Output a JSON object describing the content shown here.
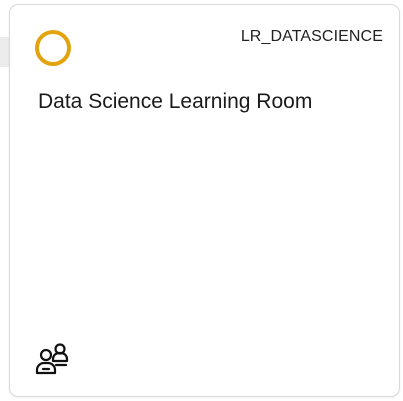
{
  "tile": {
    "code": "LR_DATASCIENCE",
    "title": "Data Science Learning Room"
  },
  "icons": {
    "status": "status-ring-icon",
    "members": "group-members-icon"
  },
  "colors": {
    "status_ring": "#e3a30f",
    "tile_border": "#d9d9d9",
    "text": "#1a1a1a"
  }
}
